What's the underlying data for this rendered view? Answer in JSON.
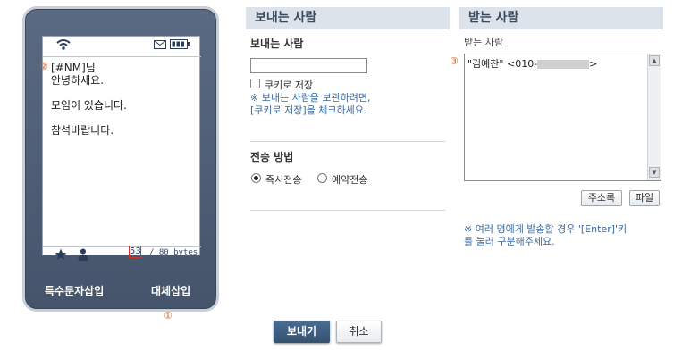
{
  "phone": {
    "marker_2": "②",
    "message": "[#NM]님\n안녕하세요.\n\n모임이 있습니다.\n\n참석바랍니다.",
    "byte_count": "53",
    "byte_limit": "/ 80 bytes",
    "special_char_button": "특수문자삽입",
    "replace_button": "대체삽입",
    "marker_1": "①"
  },
  "sender": {
    "header": "보내는 사람",
    "label": "보내는 사람",
    "input_value": "",
    "cookie_label": "쿠키로 저장",
    "cookie_checked": false,
    "cookie_note": "※ 보내는 사람을 보관하려면,\n[쿠키로 저장]을 체크하세요.",
    "send_method_label": "전송 방법",
    "send_now": "즉시전송",
    "send_reserved": "예약전송",
    "selected_method": "즉시전송"
  },
  "receiver": {
    "header": "받는 사람",
    "sublabel": "받는 사람",
    "marker_3": "③",
    "entry_prefix": "\"김예찬\" <010-",
    "entry_suffix": ">",
    "address_book_button": "주소록",
    "file_button": "파일",
    "note": "※ 여러 명에게 발송할 경우 '[Enter]'키\n를 눌러 구분해주세요."
  },
  "actions": {
    "send": "보내기",
    "cancel": "취소"
  },
  "colors": {
    "phone_body": "#4f5e75",
    "panel_header": "#dde3ea",
    "note_text": "#3a6aa0",
    "marker": "#e06020",
    "send_button": "#3e5f83"
  },
  "icons": [
    "wifi-icon",
    "mail-icon",
    "battery-icon",
    "star-icon",
    "person-icon",
    "scroll-up-icon",
    "scroll-down-icon"
  ]
}
